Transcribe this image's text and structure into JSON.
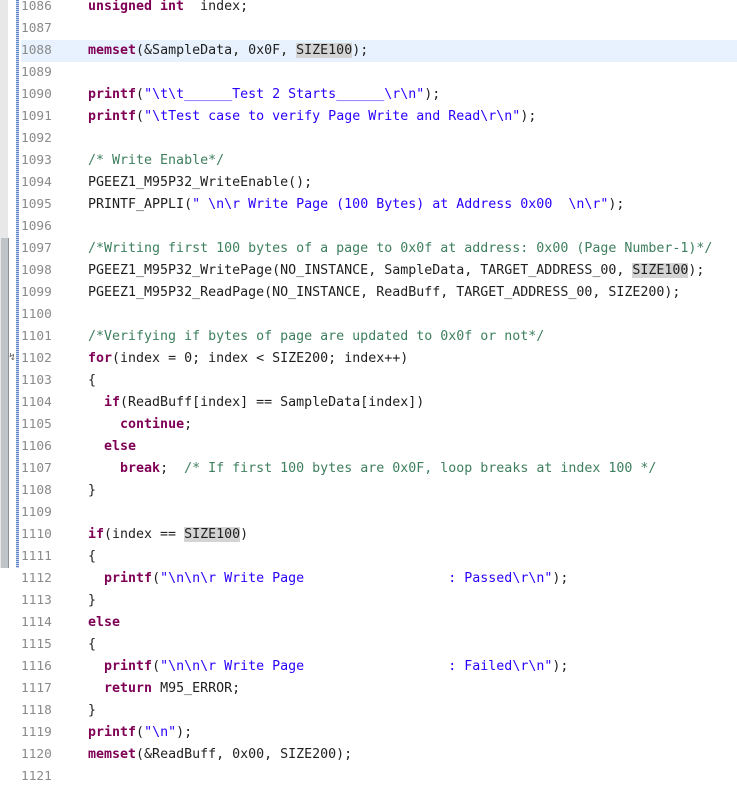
{
  "editor": {
    "current_line": "1088",
    "lines": [
      {
        "num": "1086",
        "tokens": [
          [
            "kw",
            "unsigned int"
          ],
          [
            "",
            "  index;"
          ]
        ]
      },
      {
        "num": "1087",
        "tokens": []
      },
      {
        "num": "1088",
        "tokens": [
          [
            "kw",
            "memset"
          ],
          [
            "",
            "(&SampleData, 0x0F, "
          ],
          [
            "hl",
            "SIZE100"
          ],
          [
            "",
            ");"
          ]
        ]
      },
      {
        "num": "1089",
        "tokens": []
      },
      {
        "num": "1090",
        "tokens": [
          [
            "kw",
            "printf"
          ],
          [
            "",
            "("
          ],
          [
            "str",
            "\"\\t\\t______Test 2 Starts______\\r\\n\""
          ],
          [
            "",
            ");"
          ]
        ]
      },
      {
        "num": "1091",
        "tokens": [
          [
            "kw",
            "printf"
          ],
          [
            "",
            "("
          ],
          [
            "str",
            "\"\\tTest case to verify Page Write and Read\\r\\n\""
          ],
          [
            "",
            ");"
          ]
        ]
      },
      {
        "num": "1092",
        "tokens": []
      },
      {
        "num": "1093",
        "tokens": [
          [
            "cm",
            "/* Write Enable*/"
          ]
        ]
      },
      {
        "num": "1094",
        "tokens": [
          [
            "",
            "PGEEZ1_M95P32_WriteEnable();"
          ]
        ]
      },
      {
        "num": "1095",
        "tokens": [
          [
            "",
            "PRINTF_APPLI("
          ],
          [
            "str",
            "\" \\n\\r Write Page (100 Bytes) at Address 0x00  \\n\\r\""
          ],
          [
            "",
            ");"
          ]
        ]
      },
      {
        "num": "1096",
        "tokens": []
      },
      {
        "num": "1097",
        "tokens": [
          [
            "cm",
            "/*Writing first 100 bytes of a page to 0x0f at address: 0x00 (Page Number-1)*/"
          ]
        ]
      },
      {
        "num": "1098",
        "tokens": [
          [
            "",
            "PGEEZ1_M95P32_WritePage(NO_INSTANCE, SampleData, TARGET_ADDRESS_00, "
          ],
          [
            "hl",
            "SIZE100"
          ],
          [
            "",
            ");"
          ]
        ]
      },
      {
        "num": "1099",
        "tokens": [
          [
            "",
            "PGEEZ1_M95P32_ReadPage(NO_INSTANCE, ReadBuff, TARGET_ADDRESS_00, SIZE200);"
          ]
        ]
      },
      {
        "num": "1100",
        "tokens": []
      },
      {
        "num": "1101",
        "tokens": [
          [
            "cm",
            "/*Verifying if bytes of page are updated to 0x0f or not*/"
          ]
        ]
      },
      {
        "num": "1102",
        "tokens": [
          [
            "kw",
            "for"
          ],
          [
            "",
            "(index = 0; index < SIZE200; index++)"
          ]
        ]
      },
      {
        "num": "1103",
        "tokens": [
          [
            "",
            "{"
          ]
        ]
      },
      {
        "num": "1104",
        "tokens": [
          [
            "",
            "  "
          ],
          [
            "kw",
            "if"
          ],
          [
            "",
            "(ReadBuff[index] == SampleData[index])"
          ]
        ]
      },
      {
        "num": "1105",
        "tokens": [
          [
            "",
            "    "
          ],
          [
            "kw",
            "continue"
          ],
          [
            "",
            ";"
          ]
        ]
      },
      {
        "num": "1106",
        "tokens": [
          [
            "",
            "  "
          ],
          [
            "kw",
            "else"
          ]
        ]
      },
      {
        "num": "1107",
        "tokens": [
          [
            "",
            "    "
          ],
          [
            "kw",
            "break"
          ],
          [
            "",
            ";  "
          ],
          [
            "cm",
            "/* If first 100 bytes are 0x0F, loop breaks at index 100 */"
          ]
        ]
      },
      {
        "num": "1108",
        "tokens": [
          [
            "",
            "}"
          ]
        ]
      },
      {
        "num": "1109",
        "tokens": []
      },
      {
        "num": "1110",
        "tokens": [
          [
            "kw",
            "if"
          ],
          [
            "",
            "(index == "
          ],
          [
            "hl",
            "SIZE100"
          ],
          [
            "",
            ")"
          ]
        ]
      },
      {
        "num": "1111",
        "tokens": [
          [
            "",
            "{"
          ]
        ]
      },
      {
        "num": "1112",
        "tokens": [
          [
            "",
            "  "
          ],
          [
            "kw",
            "printf"
          ],
          [
            "",
            "("
          ],
          [
            "str",
            "\"\\n\\n\\r Write Page                  : Passed\\r\\n\""
          ],
          [
            "",
            ");"
          ]
        ]
      },
      {
        "num": "1113",
        "tokens": [
          [
            "",
            "}"
          ]
        ]
      },
      {
        "num": "1114",
        "tokens": [
          [
            "kw",
            "else"
          ]
        ]
      },
      {
        "num": "1115",
        "tokens": [
          [
            "",
            "{"
          ]
        ]
      },
      {
        "num": "1116",
        "tokens": [
          [
            "",
            "  "
          ],
          [
            "kw",
            "printf"
          ],
          [
            "",
            "("
          ],
          [
            "str",
            "\"\\n\\n\\r Write Page                  : Failed\\r\\n\""
          ],
          [
            "",
            ");"
          ]
        ]
      },
      {
        "num": "1117",
        "tokens": [
          [
            "",
            "  "
          ],
          [
            "kw",
            "return"
          ],
          [
            "",
            " M95_ERROR;"
          ]
        ]
      },
      {
        "num": "1118",
        "tokens": [
          [
            "",
            "}"
          ]
        ]
      },
      {
        "num": "1119",
        "tokens": [
          [
            "kw",
            "printf"
          ],
          [
            "",
            "("
          ],
          [
            "str",
            "\"\\n\""
          ],
          [
            "",
            ");"
          ]
        ]
      },
      {
        "num": "1120",
        "tokens": [
          [
            "kw",
            "memset"
          ],
          [
            "",
            "(&ReadBuff, 0x00, SIZE200);"
          ]
        ]
      },
      {
        "num": "1121",
        "tokens": []
      }
    ]
  }
}
